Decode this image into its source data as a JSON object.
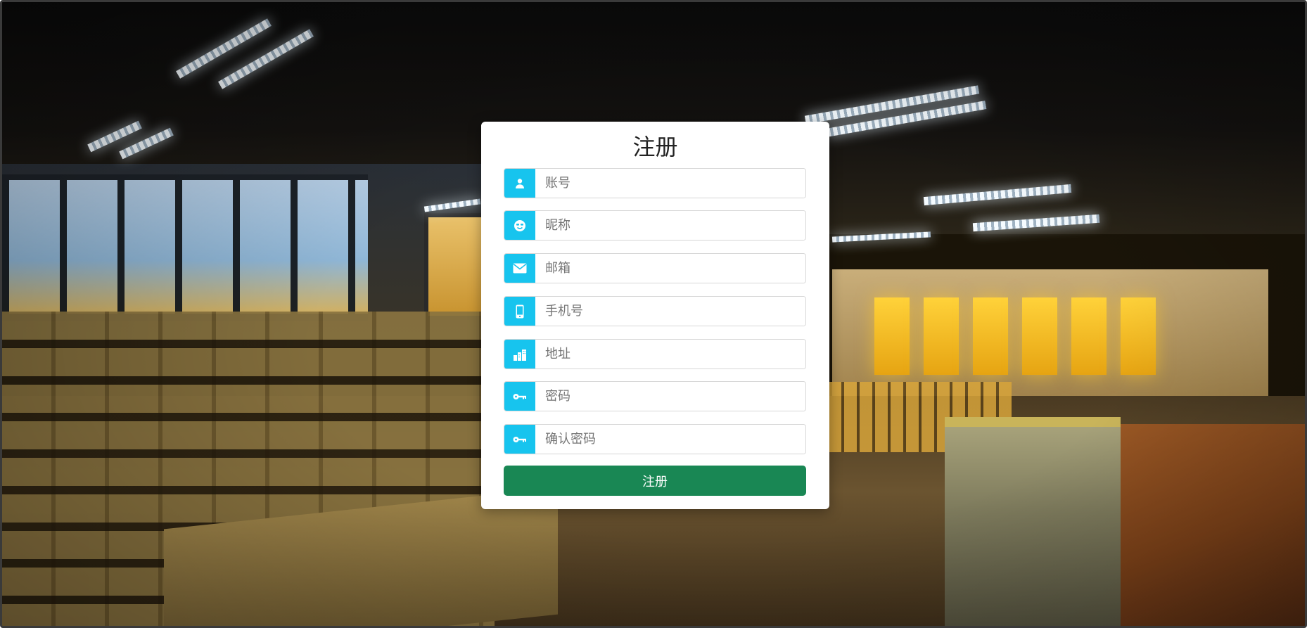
{
  "form": {
    "title": "注册",
    "fields": [
      {
        "placeholder": "账号",
        "icon": "user-icon"
      },
      {
        "placeholder": "昵称",
        "icon": "smiley-icon"
      },
      {
        "placeholder": "邮箱",
        "icon": "envelope-icon"
      },
      {
        "placeholder": "手机号",
        "icon": "phone-icon"
      },
      {
        "placeholder": "地址",
        "icon": "building-icon"
      },
      {
        "placeholder": "密码",
        "icon": "key-icon"
      },
      {
        "placeholder": "确认密码",
        "icon": "key-icon"
      }
    ],
    "submit_label": "注册"
  },
  "colors": {
    "icon_addon": "#17c4ee",
    "submit_button": "#198754",
    "card_background": "#ffffff"
  }
}
